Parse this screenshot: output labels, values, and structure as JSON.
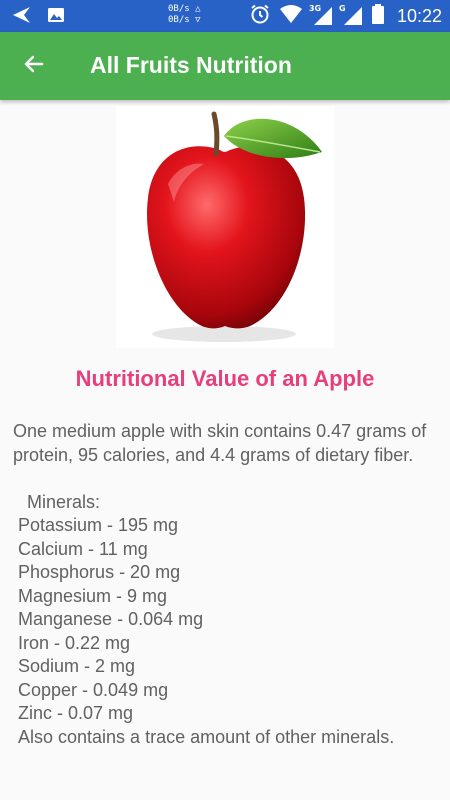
{
  "status_bar": {
    "net_speed_up": "0B/s △",
    "net_speed_down": "0B/s ▽",
    "sig_3g_label": "3G",
    "sig_g_label": "G",
    "time": "10:22"
  },
  "app_bar": {
    "title": "All Fruits Nutrition"
  },
  "content": {
    "heading": "Nutritional Value of an Apple",
    "intro": "One medium apple with skin contains 0.47 grams of protein, 95 calories, and 4.4 grams of dietary fiber.",
    "minerals_heading": "Minerals:",
    "minerals": [
      "Potassium - 195 mg",
      "Calcium - 11 mg",
      "Phosphorus - 20 mg",
      "Magnesium - 9 mg",
      "Manganese - 0.064 mg",
      "Iron - 0.22 mg",
      "Sodium - 2 mg",
      "Copper - 0.049 mg",
      "Zinc - 0.07 mg"
    ],
    "trace_note": "Also contains a trace amount of other minerals."
  },
  "colors": {
    "status_bar": "#2962c6",
    "app_bar": "#4caf50",
    "heading": "#e83e7b",
    "body_text": "#616161"
  },
  "icons": [
    "back-triangle-icon",
    "image-notification-icon",
    "alarm-icon",
    "wifi-icon",
    "signal-3g-icon",
    "signal-g-icon",
    "battery-icon",
    "back-arrow-icon",
    "apple-image"
  ]
}
